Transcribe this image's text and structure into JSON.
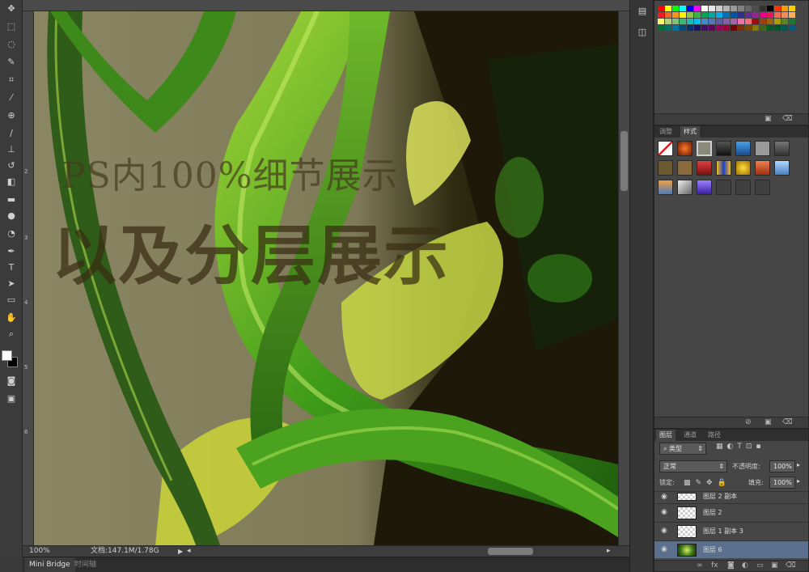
{
  "toolbar": {
    "tools": [
      "move-tool-icon",
      "marquee-tool-icon",
      "lasso-tool-icon",
      "quick-select-tool-icon",
      "crop-tool-icon",
      "eyedropper-tool-icon",
      "healing-brush-tool-icon",
      "brush-tool-icon",
      "clone-stamp-tool-icon",
      "history-brush-tool-icon",
      "eraser-tool-icon",
      "gradient-tool-icon",
      "blur-tool-icon",
      "dodge-tool-icon",
      "pen-tool-icon",
      "type-tool-icon",
      "path-select-tool-icon",
      "shape-tool-icon",
      "hand-tool-icon",
      "zoom-tool-icon"
    ],
    "foreground_color": "#ffffff",
    "background_color": "#000000"
  },
  "ruler": {
    "left_numbers": [
      "2",
      "3",
      "4",
      "5",
      "6"
    ]
  },
  "canvas": {
    "overlay_line1": "PS内100%细节展示",
    "overlay_line2": "以及分层展示"
  },
  "statusbar": {
    "zoom": "100%",
    "doc_size": "文档:147.1M/1.78G"
  },
  "bottom_tabs": [
    "Mini Bridge",
    "时间轴"
  ],
  "swatches_panel": {
    "colors": [
      "#ff0000",
      "#ffff00",
      "#00ff00",
      "#00ffff",
      "#0000ff",
      "#ff00ff",
      "#ffffff",
      "#e6e6e6",
      "#cccccc",
      "#b3b3b3",
      "#999999",
      "#808080",
      "#666666",
      "#4d4d4d",
      "#333333",
      "#000000",
      "#ff3300",
      "#ff9900",
      "#ffcc00",
      "#ee1c24",
      "#f26522",
      "#f7941d",
      "#fff200",
      "#8dc63f",
      "#39b54a",
      "#00a651",
      "#00a99d",
      "#00aeef",
      "#0072bc",
      "#0054a6",
      "#2e3192",
      "#662d91",
      "#92278f",
      "#ec008c",
      "#ed145b",
      "#f26c4f",
      "#f68e56",
      "#fbaf5d",
      "#fff568",
      "#acd373",
      "#7cc576",
      "#3bb878",
      "#1abbb4",
      "#00bff3",
      "#438ccb",
      "#5574b9",
      "#605ca8",
      "#855fa8",
      "#a864a8",
      "#f06eaa",
      "#f26d7d",
      "#9e0b0f",
      "#a0410d",
      "#a36209",
      "#aba000",
      "#598527",
      "#1a7b30",
      "#007236",
      "#00746b",
      "#0076a3",
      "#004b80",
      "#003471",
      "#1b1464",
      "#440e62",
      "#630460",
      "#9e005d",
      "#9e0039",
      "#790000",
      "#7b2e00",
      "#7d4900",
      "#827b00",
      "#406618",
      "#005e20",
      "#005826",
      "#005952",
      "#005b7f"
    ]
  },
  "styles_panel": {
    "tabs": [
      "调整",
      "样式"
    ],
    "active_tab": "样式"
  },
  "layers_panel": {
    "tabs": [
      "图层",
      "通道",
      "路径"
    ],
    "active_tab": "图层",
    "filter_kind": "类型",
    "blend_mode": "正常",
    "opacity_label": "不透明度:",
    "opacity_value": "100%",
    "lock_label": "锁定:",
    "fill_label": "填充:",
    "fill_value": "100%",
    "layers": [
      {
        "name": "图层 2 副本",
        "selected": false
      },
      {
        "name": "图层 2",
        "selected": false
      },
      {
        "name": "图层 1 副本 3",
        "selected": false
      },
      {
        "name": "图层 6",
        "selected": true
      }
    ]
  }
}
